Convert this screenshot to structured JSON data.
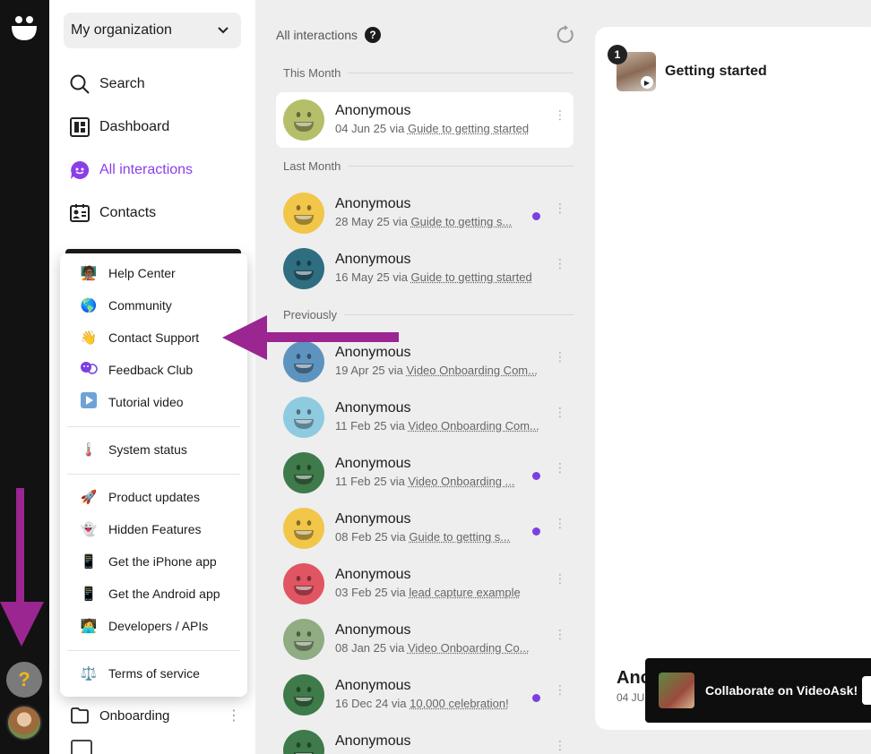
{
  "sidebar": {
    "org_select": "My organization",
    "nav": [
      {
        "label": "Search",
        "icon": "search-icon"
      },
      {
        "label": "Dashboard",
        "icon": "dashboard-icon"
      },
      {
        "label": "All interactions",
        "icon": "chat-icon",
        "active": true
      },
      {
        "label": "Contacts",
        "icon": "contacts-icon"
      }
    ],
    "folder": {
      "label": "Onboarding",
      "icon": "folder-icon"
    }
  },
  "help_menu": {
    "items": [
      {
        "label": "Help Center",
        "emoji": "🧑🏾‍🏫"
      },
      {
        "label": "Community",
        "emoji": "🌎"
      },
      {
        "label": "Contact Support",
        "emoji": "👋"
      },
      {
        "label": "Feedback Club",
        "emoji": "💬"
      },
      {
        "label": "Tutorial video",
        "emoji": "▶️"
      },
      {
        "label": "System status",
        "emoji": "🌡️"
      },
      {
        "label": "Product updates",
        "emoji": "🚀"
      },
      {
        "label": "Hidden Features",
        "emoji": "👻"
      },
      {
        "label": "Get the iPhone app",
        "emoji": "📱"
      },
      {
        "label": "Get the Android app",
        "emoji": "📱"
      },
      {
        "label": "Developers / APIs",
        "emoji": "🧑‍💻"
      },
      {
        "label": "Terms of service",
        "emoji": "⚖️"
      }
    ]
  },
  "rail": {
    "help_label": "?"
  },
  "list": {
    "title": "All interactions",
    "help": "?",
    "sections": {
      "this_month": "This Month",
      "last_month": "Last Month",
      "previously": "Previously"
    },
    "rows": [
      {
        "name": "Anonymous",
        "date": "04 Jun 25 via ",
        "via": "Guide to getting started",
        "color": "#b5bf6a",
        "unread": false
      },
      {
        "name": "Anonymous",
        "date": "28 May 25 via ",
        "via": "Guide to getting s...",
        "color": "#f2c649",
        "unread": true
      },
      {
        "name": "Anonymous",
        "date": "16 May 25 via ",
        "via": "Guide to getting started",
        "color": "#2f6d80",
        "unread": false
      },
      {
        "name": "Anonymous",
        "date": "19 Apr 25 via ",
        "via": "Video Onboarding Com...",
        "color": "#5d93bf",
        "unread": false
      },
      {
        "name": "Anonymous",
        "date": "11 Feb 25 via ",
        "via": "Video Onboarding Com...",
        "color": "#8fcbe0",
        "unread": false
      },
      {
        "name": "Anonymous",
        "date": "11 Feb 25 via ",
        "via": "Video Onboarding ...",
        "color": "#3f7a4a",
        "unread": true
      },
      {
        "name": "Anonymous",
        "date": "08 Feb 25 via ",
        "via": "Guide to getting s...",
        "color": "#f2c649",
        "unread": true
      },
      {
        "name": "Anonymous",
        "date": "03 Feb 25 via ",
        "via": "lead capture example",
        "color": "#e05561",
        "unread": false
      },
      {
        "name": "Anonymous",
        "date": "08 Jan 25 via ",
        "via": "Video Onboarding Co...",
        "color": "#8fac82",
        "unread": false
      },
      {
        "name": "Anonymous",
        "date": "16 Dec 24 via ",
        "via": "10,000 celebration!",
        "color": "#3f7a4a",
        "unread": true
      },
      {
        "name": "Anonymous",
        "date": "",
        "via": "",
        "color": "#3f7a4a",
        "unread": false
      }
    ]
  },
  "detail": {
    "step_number": "1",
    "step_title": "Getting started",
    "name_partial": "Anc",
    "date_partial": "04 JU"
  },
  "toast": {
    "text": "Collaborate on VideoAsk!"
  },
  "colors": {
    "accent": "#8a3fe8",
    "annotation": "#9b2591"
  }
}
